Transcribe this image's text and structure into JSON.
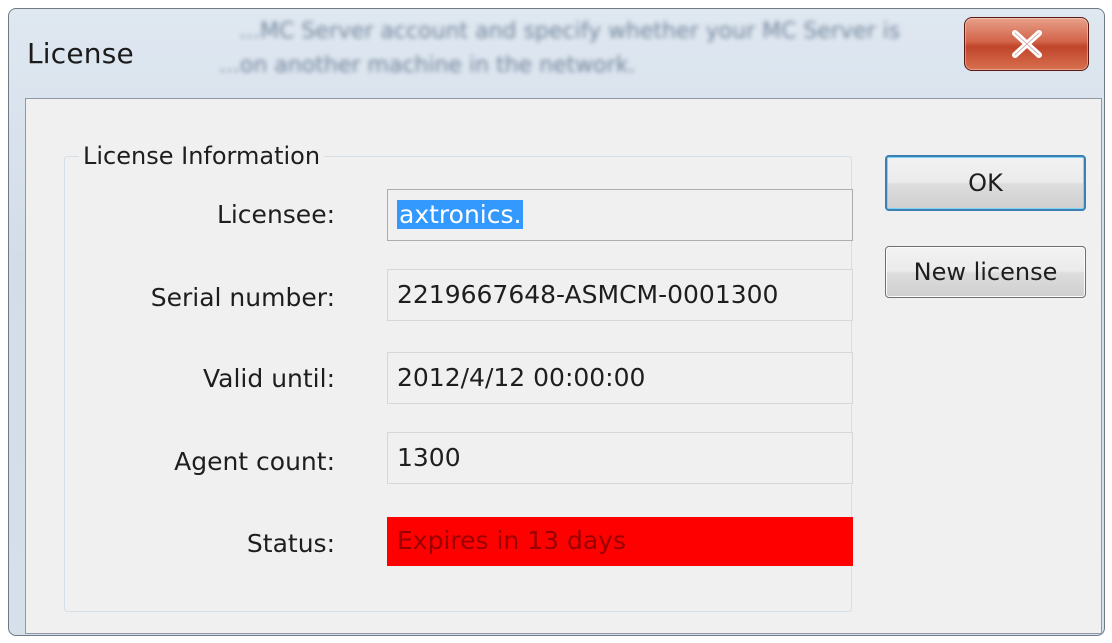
{
  "window": {
    "title": "License",
    "background_text": {
      "line1": "...MC Server account and specify whether your MC Server is",
      "line2": "...on another machine in the network."
    }
  },
  "group": {
    "label": "License Information"
  },
  "fields": {
    "licensee": {
      "label": "Licensee:",
      "value": "axtronics."
    },
    "serial": {
      "label": "Serial number:",
      "value": "2219667648-ASMCM-0001300"
    },
    "valid_until": {
      "label": "Valid until:",
      "value": "2012/4/12 00:00:00"
    },
    "agent_count": {
      "label": "Agent count:",
      "value": "1300"
    },
    "status": {
      "label": "Status:",
      "value": "Expires in 13 days"
    }
  },
  "buttons": {
    "ok": "OK",
    "new_license": "New license"
  },
  "icons": {
    "close": "close-icon"
  },
  "colors": {
    "status_bg": "#ff0000",
    "selection": "#3399ff",
    "close_button": "#c0452a"
  }
}
